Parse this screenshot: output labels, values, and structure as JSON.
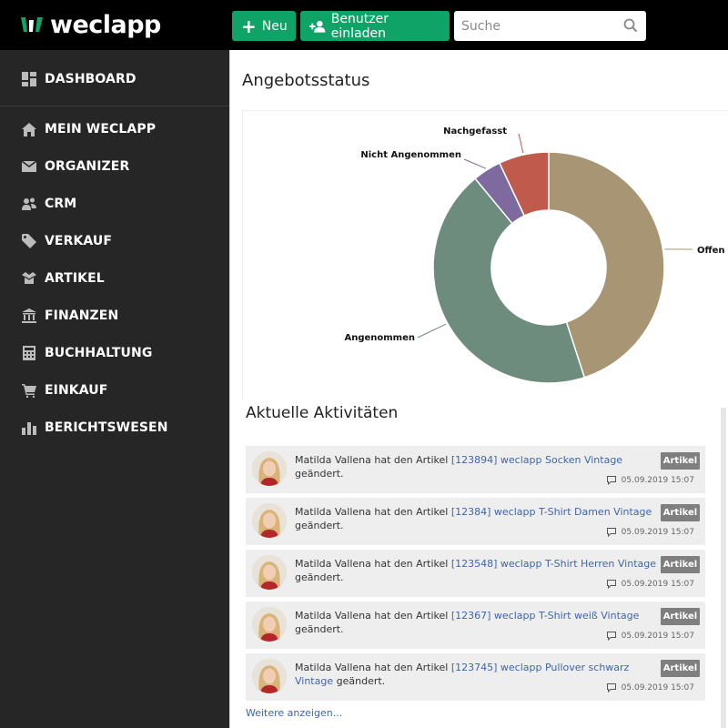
{
  "app": {
    "logo_text": "weclapp",
    "brand_color": "#10a368"
  },
  "toolbar": {
    "new_label": "Neu",
    "invite_label": "Benutzer einladen",
    "search_placeholder": "Suche"
  },
  "sidebar": {
    "items": [
      {
        "label": "DASHBOARD",
        "icon": "dashboard-icon"
      },
      {
        "label": "MEIN WECLAPP",
        "icon": "home-icon"
      },
      {
        "label": "ORGANIZER",
        "icon": "envelope-icon"
      },
      {
        "label": "CRM",
        "icon": "contacts-icon"
      },
      {
        "label": "VERKAUF",
        "icon": "tag-icon"
      },
      {
        "label": "ARTIKEL",
        "icon": "box-icon"
      },
      {
        "label": "FINANZEN",
        "icon": "bank-icon"
      },
      {
        "label": "BUCHHALTUNG",
        "icon": "calculator-icon"
      },
      {
        "label": "EINKAUF",
        "icon": "cart-icon"
      },
      {
        "label": "BERICHTSWESEN",
        "icon": "bar-chart-icon"
      }
    ]
  },
  "main": {
    "title": "Angebotsstatus"
  },
  "chart_data": {
    "type": "pie",
    "donut": true,
    "title": "",
    "slices": [
      {
        "label": "Offen",
        "value": 45,
        "color": "#a89574"
      },
      {
        "label": "Angenommen",
        "value": 44,
        "color": "#6e8c7e"
      },
      {
        "label": "Nicht Angenommen",
        "value": 4,
        "color": "#7e6a9e"
      },
      {
        "label": "Nachgefasst",
        "value": 7,
        "color": "#c05a4c"
      }
    ]
  },
  "activities": {
    "title": "Aktuelle Aktivitäten",
    "more_label": "Weitere anzeigen...",
    "items": [
      {
        "prefix": "Matilda Vallena hat den Artikel ",
        "link": "[123894] weclapp Socken Vintage",
        "suffix": " geändert.",
        "badge": "Artikel",
        "timestamp": "05.09.2019 15:07"
      },
      {
        "prefix": "Matilda Vallena hat den Artikel ",
        "link": "[12384] weclapp T-Shirt Damen Vintage",
        "suffix": " geändert.",
        "badge": "Artikel",
        "timestamp": "05.09.2019 15:07"
      },
      {
        "prefix": "Matilda Vallena hat den Artikel ",
        "link": "[123548] weclapp T-Shirt Herren Vintage",
        "suffix": " geändert.",
        "badge": "Artikel",
        "timestamp": "05.09.2019 15:07"
      },
      {
        "prefix": "Matilda Vallena hat den Artikel ",
        "link": "[12367] weclapp T-Shirt weiß Vintage",
        "suffix": " geändert.",
        "badge": "Artikel",
        "timestamp": "05.09.2019 15:07"
      },
      {
        "prefix": "Matilda Vallena hat den Artikel ",
        "link": "[123745] weclapp Pullover schwarz Vintage",
        "suffix": " geändert.",
        "badge": "Artikel",
        "timestamp": "05.09.2019 15:07"
      }
    ]
  }
}
